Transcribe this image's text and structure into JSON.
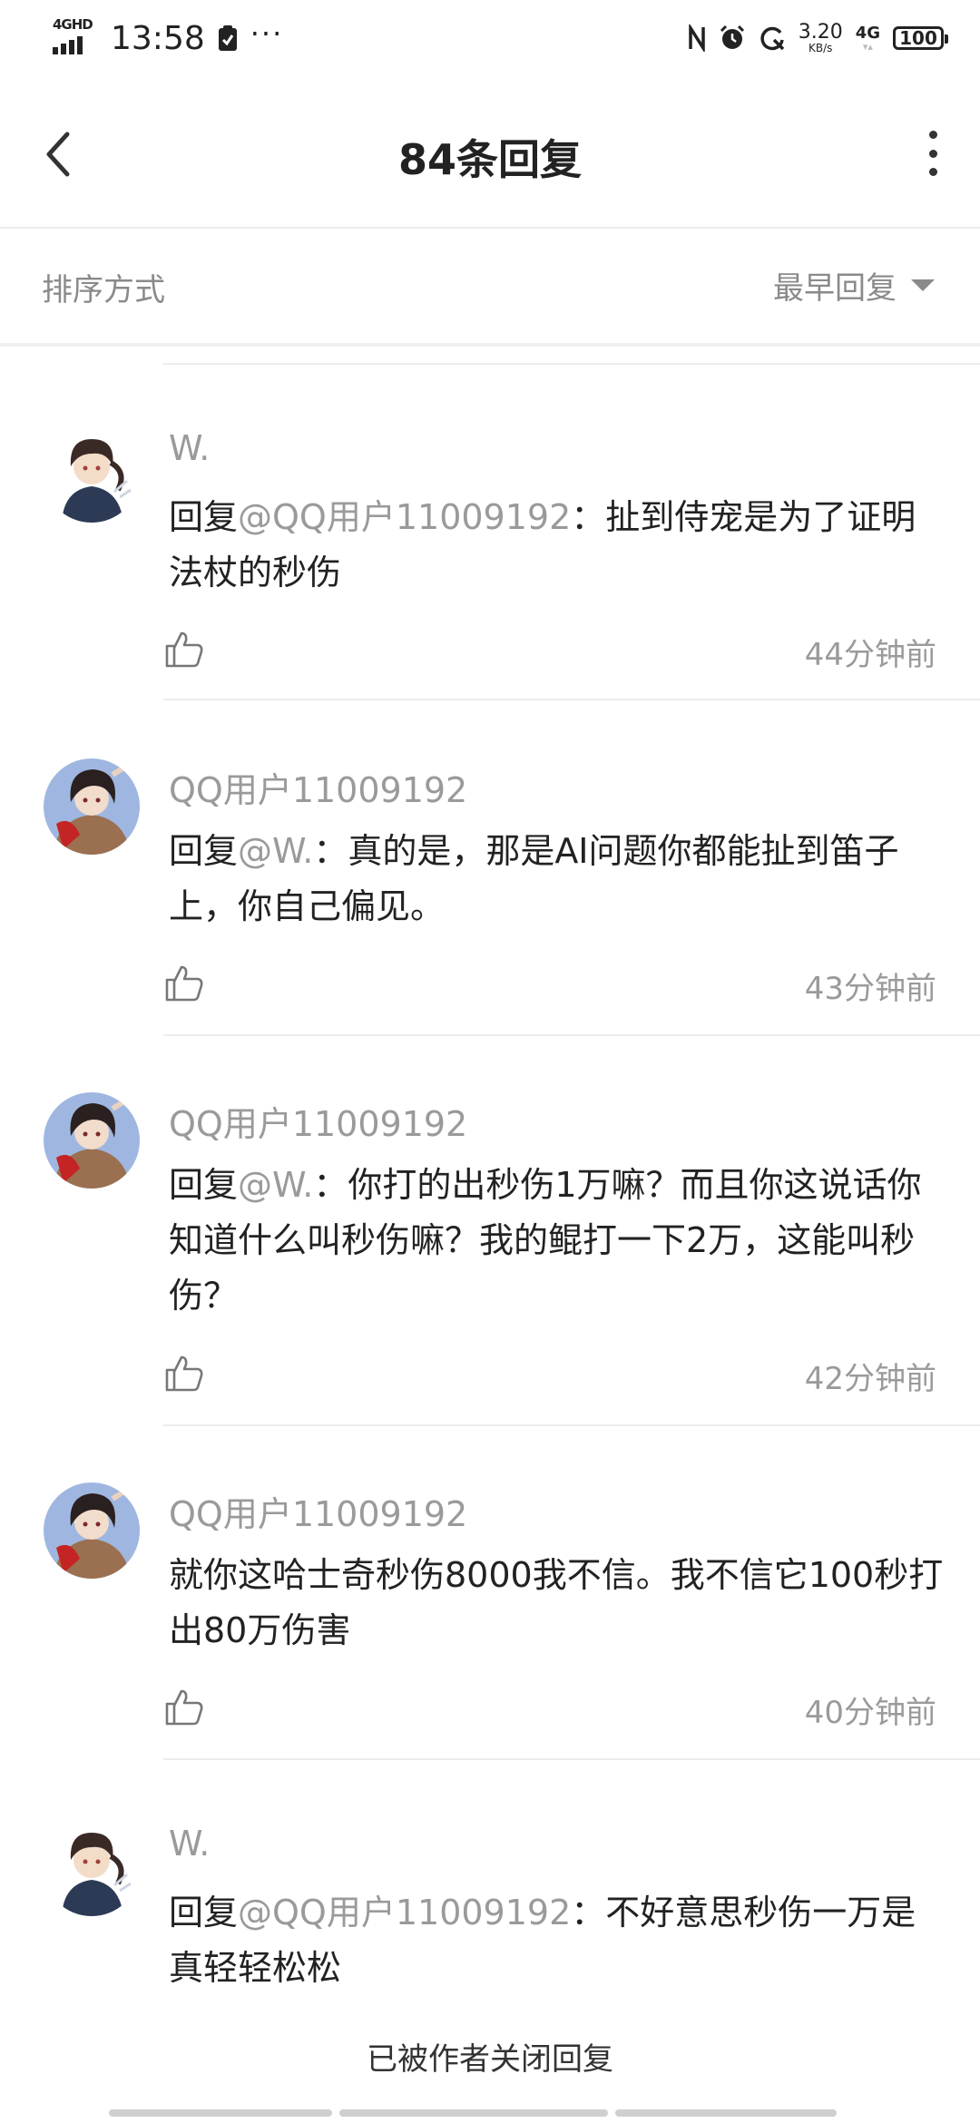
{
  "status_bar": {
    "network_tag": "4GHD",
    "time": "13:58",
    "more": "···",
    "speed_value": "3.20",
    "speed_unit": "KB/s",
    "net_type": "4G",
    "battery": "100"
  },
  "header": {
    "title": "84条回复"
  },
  "sort": {
    "label": "排序方式",
    "selected": "最早回复"
  },
  "comments": [
    {
      "user": "W.",
      "reply_prefix": "回复",
      "mention": "@QQ用户11009192",
      "body": "：扯到侍宠是为了证明法杖的秒伤",
      "time": "44分钟前"
    },
    {
      "user": "QQ用户11009192",
      "reply_prefix": "回复",
      "mention": "@W.",
      "body": "：真的是，那是AI问题你都能扯到笛子上，你自己偏见。",
      "time": "43分钟前"
    },
    {
      "user": "QQ用户11009192",
      "reply_prefix": "回复",
      "mention": "@W.",
      "body": "：你打的出秒伤1万嘛？而且你这说话你知道什么叫秒伤嘛？我的鲲打一下2万，这能叫秒伤？",
      "time": "42分钟前"
    },
    {
      "user": "QQ用户11009192",
      "reply_prefix": "",
      "mention": "",
      "body": "就你这哈士奇秒伤8000我不信。我不信它100秒打出80万伤害",
      "time": "40分钟前"
    },
    {
      "user": "W.",
      "reply_prefix": "回复",
      "mention": "@QQ用户11009192",
      "body": "：不好意思秒伤一万是真轻轻松松",
      "time": ""
    }
  ],
  "footer": {
    "closed_text": "已被作者关闭回复"
  },
  "colors": {
    "secondary_text": "#9a9a9a",
    "primary_text": "#222222",
    "divider": "#ececec"
  },
  "icons": [
    "back-arrow-icon",
    "more-vertical-icon",
    "caret-down-icon",
    "thumbs-up-icon"
  ]
}
